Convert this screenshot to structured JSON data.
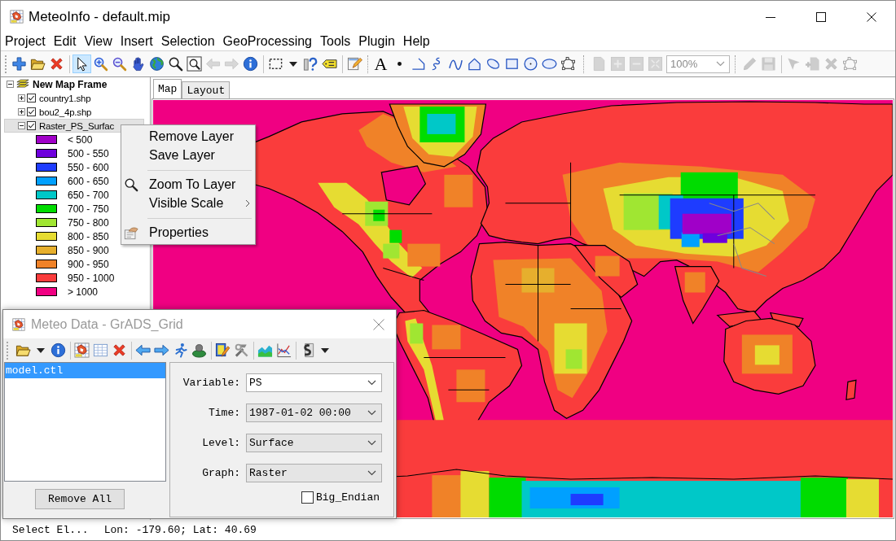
{
  "window": {
    "title": "MeteoInfo - default.mip"
  },
  "menu_bar": [
    "Project",
    "Edit",
    "View",
    "Insert",
    "Selection",
    "GeoProcessing",
    "Tools",
    "Plugin",
    "Help"
  ],
  "toolbar": {
    "tools": [
      {
        "selected": false,
        "disabled": false
      },
      {
        "selected": false,
        "disabled": false
      },
      {
        "selected": false,
        "disabled": false
      },
      {
        "selected": true,
        "disabled": false
      },
      {
        "selected": false,
        "disabled": false
      },
      {
        "selected": false,
        "disabled": false
      },
      {
        "selected": false,
        "disabled": false
      },
      {
        "selected": false,
        "disabled": false
      },
      {
        "selected": false,
        "disabled": false
      },
      {
        "selected": false,
        "disabled": false
      },
      {
        "selected": false,
        "disabled": true
      },
      {
        "selected": false,
        "disabled": true
      },
      {
        "selected": false,
        "disabled": false
      },
      {
        "selected": false,
        "disabled": false
      },
      {
        "selected": false,
        "disabled": false
      },
      {
        "selected": false,
        "disabled": false
      },
      {
        "selected": false,
        "disabled": false
      },
      {
        "selected": false,
        "disabled": false
      },
      {
        "glyph": "A",
        "selected": false,
        "disabled": false
      },
      {
        "selected": false,
        "disabled": false
      },
      {
        "selected": false,
        "disabled": false
      },
      {
        "selected": false,
        "disabled": false
      },
      {
        "selected": false,
        "disabled": false
      },
      {
        "selected": false,
        "disabled": false
      },
      {
        "selected": false,
        "disabled": false
      },
      {
        "selected": false,
        "disabled": false
      },
      {
        "selected": false,
        "disabled": false
      },
      {
        "selected": false,
        "disabled": false
      },
      {
        "selected": false,
        "disabled": false
      },
      {
        "selected": false,
        "disabled": true
      },
      {
        "selected": false,
        "disabled": true
      },
      {
        "selected": false,
        "disabled": true
      },
      {
        "selected": false,
        "disabled": true
      },
      {
        "selected": false,
        "disabled": true
      },
      {
        "selected": false,
        "disabled": true
      },
      {
        "selected": false,
        "disabled": true
      },
      {
        "selected": false,
        "disabled": true
      },
      {
        "selected": false,
        "disabled": true
      },
      {
        "selected": false,
        "disabled": true
      }
    ],
    "zoom_combo": {
      "value": "100%",
      "disabled": true
    }
  },
  "layers": {
    "label": "New Map Frame",
    "expanded": true,
    "children": [
      {
        "label": "country1.shp",
        "expanded": false,
        "checked": true,
        "selected": false
      },
      {
        "label": "bou2_4p.shp",
        "expanded": false,
        "checked": true,
        "selected": false
      },
      {
        "label": "Raster_PS_Surfac",
        "expanded": true,
        "checked": true,
        "selected": true,
        "children": [
          {
            "label": "< 500",
            "color": "#a000c8"
          },
          {
            "label": "500 - 550",
            "color": "#6e00dc"
          },
          {
            "label": "550 - 600",
            "color": "#1e3cff"
          },
          {
            "label": "600 - 650",
            "color": "#00a0ff"
          },
          {
            "label": "650 - 700",
            "color": "#00c8c8"
          },
          {
            "label": "700 - 750",
            "color": "#00dc00"
          },
          {
            "label": "750 - 800",
            "color": "#a0e632"
          },
          {
            "label": "800 - 850",
            "color": "#e6dc32"
          },
          {
            "label": "850 - 900",
            "color": "#e6af2d"
          },
          {
            "label": "900 - 950",
            "color": "#f08228"
          },
          {
            "label": "950 - 1000",
            "color": "#fa3c3c"
          },
          {
            "label": "> 1000",
            "color": "#f00082"
          }
        ]
      }
    ]
  },
  "tabs": [
    {
      "label": "Map",
      "selected": true
    },
    {
      "label": "Layout",
      "selected": false
    }
  ],
  "context_menu": {
    "items": [
      {
        "kind": "item",
        "label": "Remove Layer"
      },
      {
        "kind": "item",
        "label": "Save Layer"
      },
      {
        "kind": "separator"
      },
      {
        "kind": "item",
        "label": "Zoom To Layer"
      },
      {
        "kind": "submenu",
        "label": "Visible Scale"
      },
      {
        "kind": "separator"
      },
      {
        "kind": "item",
        "label": "Properties"
      }
    ]
  },
  "meteo_data": {
    "title": "Meteo Data - GrADS_Grid",
    "active": false,
    "files": [
      {
        "name": "model.ctl",
        "selected": true
      }
    ],
    "remove_all": "Remove All",
    "fields": [
      {
        "label": "Variable:",
        "value": "PS",
        "editable": true
      },
      {
        "label": "Time:",
        "value": "1987-01-02 00:00",
        "editable": false
      },
      {
        "label": "Level:",
        "value": "Surface",
        "editable": false
      },
      {
        "label": "Graph:",
        "value": "Raster",
        "editable": false
      }
    ],
    "big_endian": {
      "label": "Big_Endian",
      "checked": false
    }
  },
  "status_bar": {
    "message": "Select El...",
    "coordinates": "Lon: -179.60; Lat: 40.69"
  }
}
